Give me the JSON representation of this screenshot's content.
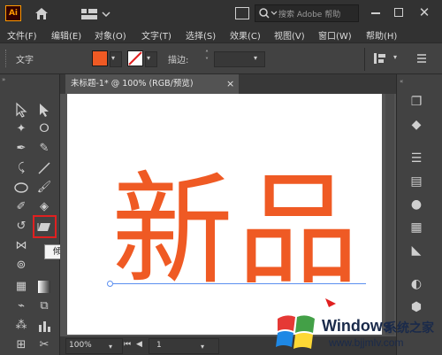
{
  "app": {
    "logo": "Ai",
    "search_placeholder": "搜索 Adobe 帮助"
  },
  "menu": [
    "文件(F)",
    "编辑(E)",
    "对象(O)",
    "文字(T)",
    "选择(S)",
    "效果(C)",
    "视图(V)",
    "窗口(W)",
    "帮助(H)"
  ],
  "control_bar": {
    "type_label": "文字",
    "stroke_label": "描边:"
  },
  "tab": {
    "title": "未标题-1* @ 100% (RGB/预览)",
    "close": "×"
  },
  "tooltip": "倾斜工具",
  "artboard": {
    "text": "新品",
    "text_color": "#ef5a24"
  },
  "status": {
    "zoom": "100%",
    "page": "1"
  },
  "colors": {
    "fill": "#ef5a24",
    "highlight": "#e02020",
    "baseline": "#5b8ff0"
  },
  "watermark": {
    "brand": "Windows",
    "cn": "系统之家",
    "url": "www.bjjmlv.com"
  }
}
